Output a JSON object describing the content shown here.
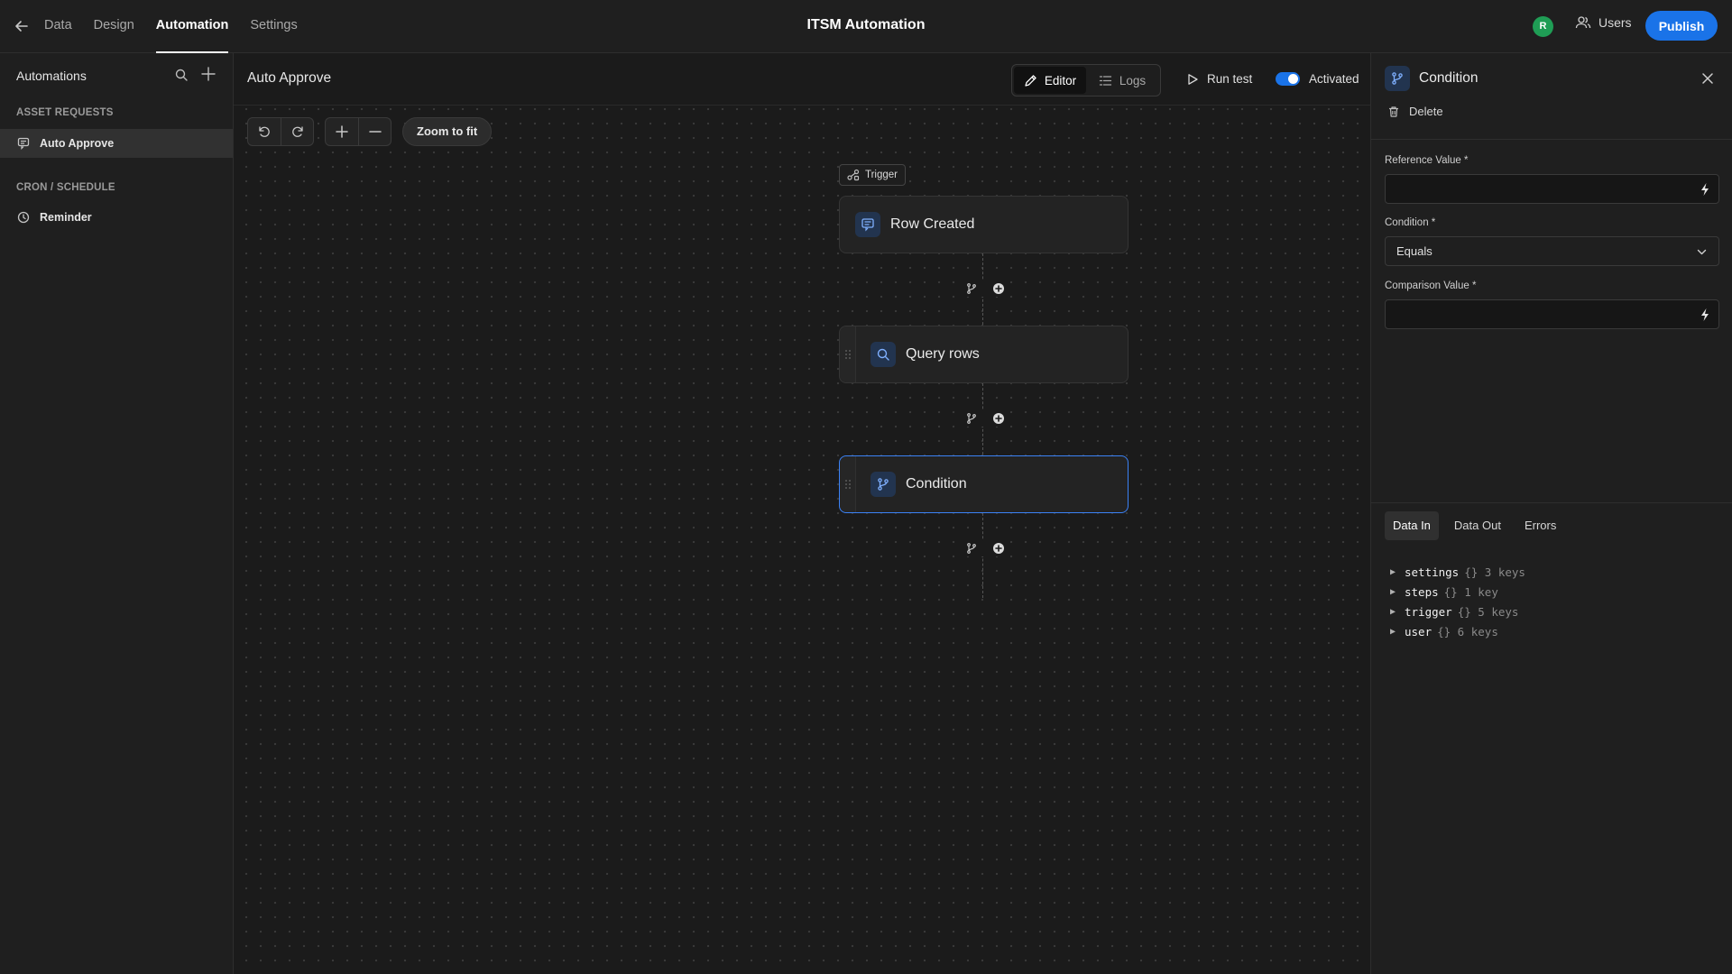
{
  "topbar": {
    "title": "ITSM Automation",
    "tabs": [
      {
        "label": "Data"
      },
      {
        "label": "Design"
      },
      {
        "label": "Automation"
      },
      {
        "label": "Settings"
      }
    ],
    "active_tab": "Automation",
    "avatar_initial": "R",
    "users_label": "Users",
    "publish_label": "Publish",
    "colors": {
      "publish": "#1a73e8",
      "avatar": "#1f9d55"
    }
  },
  "sidebar": {
    "title": "Automations",
    "sections": [
      {
        "label": "ASSET REQUESTS",
        "items": [
          {
            "label": "Auto Approve",
            "icon": "row-created-icon",
            "selected": true
          }
        ]
      },
      {
        "label": "CRON / SCHEDULE",
        "items": [
          {
            "label": "Reminder",
            "icon": "clock-icon",
            "selected": false
          }
        ]
      }
    ]
  },
  "canvas": {
    "automation_name": "Auto Approve",
    "modes": [
      {
        "label": "Editor",
        "active": true
      },
      {
        "label": "Logs",
        "active": false
      }
    ],
    "run_test_label": "Run test",
    "activated_label": "Activated",
    "activated": true,
    "zoom_fit_label": "Zoom to fit",
    "trigger_badge": "Trigger",
    "nodes": [
      {
        "label": "Row Created",
        "icon": "row-created-icon",
        "selected": false
      },
      {
        "label": "Query rows",
        "icon": "search-icon",
        "selected": false
      },
      {
        "label": "Condition",
        "icon": "branch-icon",
        "selected": true
      }
    ]
  },
  "panel": {
    "title": "Condition",
    "delete_label": "Delete",
    "fields": [
      {
        "label": "Reference Value *",
        "value": "",
        "type": "binding"
      },
      {
        "label": "Condition *",
        "value": "Equals",
        "type": "select"
      },
      {
        "label": "Comparison Value *",
        "value": "",
        "type": "binding"
      }
    ],
    "data_tabs": [
      {
        "label": "Data In",
        "active": true
      },
      {
        "label": "Data Out",
        "active": false
      },
      {
        "label": "Errors",
        "active": false
      }
    ],
    "tree": [
      {
        "key": "settings",
        "meta": "{} 3 keys"
      },
      {
        "key": "steps",
        "meta": "{} 1 key"
      },
      {
        "key": "trigger",
        "meta": "{} 5 keys"
      },
      {
        "key": "user",
        "meta": "{} 6 keys"
      }
    ]
  }
}
